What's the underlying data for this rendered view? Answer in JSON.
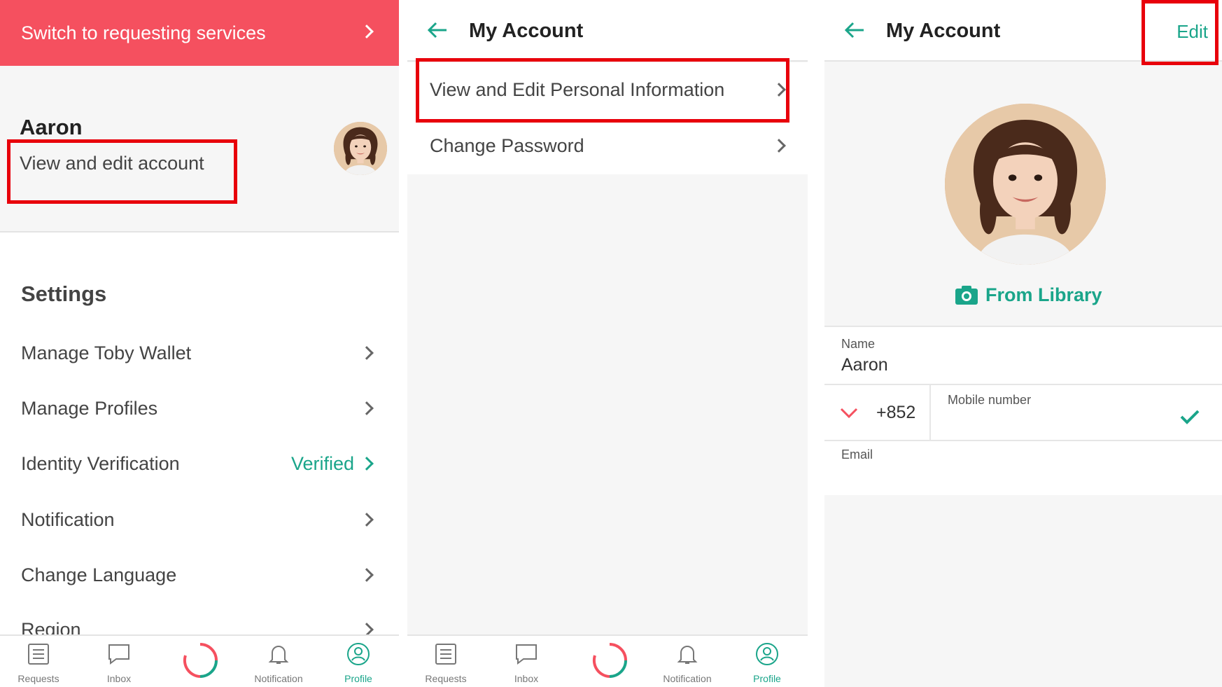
{
  "colors": {
    "accent_green": "#1aa58a",
    "banner_red": "#f5505f",
    "highlight_red": "#e8000b"
  },
  "panel1": {
    "switch_banner": "Switch to requesting services",
    "user_name": "Aaron",
    "view_edit_link": "View and edit account",
    "settings_heading": "Settings",
    "settings_items": [
      {
        "label": "Manage Toby Wallet",
        "value": ""
      },
      {
        "label": "Manage Profiles",
        "value": ""
      },
      {
        "label": "Identity Verification",
        "value": "Verified"
      },
      {
        "label": "Notification",
        "value": ""
      },
      {
        "label": "Change Language",
        "value": ""
      },
      {
        "label": "Region",
        "value": ""
      }
    ]
  },
  "tabbar": {
    "tabs": [
      {
        "label": "Requests",
        "icon": "list-icon"
      },
      {
        "label": "Inbox",
        "icon": "chat-icon"
      },
      {
        "label": "",
        "icon": "loading-ring-icon"
      },
      {
        "label": "Notification",
        "icon": "bell-icon"
      },
      {
        "label": "Profile",
        "icon": "profile-icon",
        "active": true
      }
    ]
  },
  "panel2": {
    "title": "My Account",
    "menu": [
      "View and Edit Personal Information",
      "Change Password"
    ]
  },
  "panel3": {
    "title": "My Account",
    "edit_label": "Edit",
    "from_library": "From Library",
    "name_label": "Name",
    "name_value": "Aaron",
    "country_code": "+852",
    "mobile_label": "Mobile number",
    "mobile_value": "",
    "email_label": "Email",
    "email_value": ""
  }
}
